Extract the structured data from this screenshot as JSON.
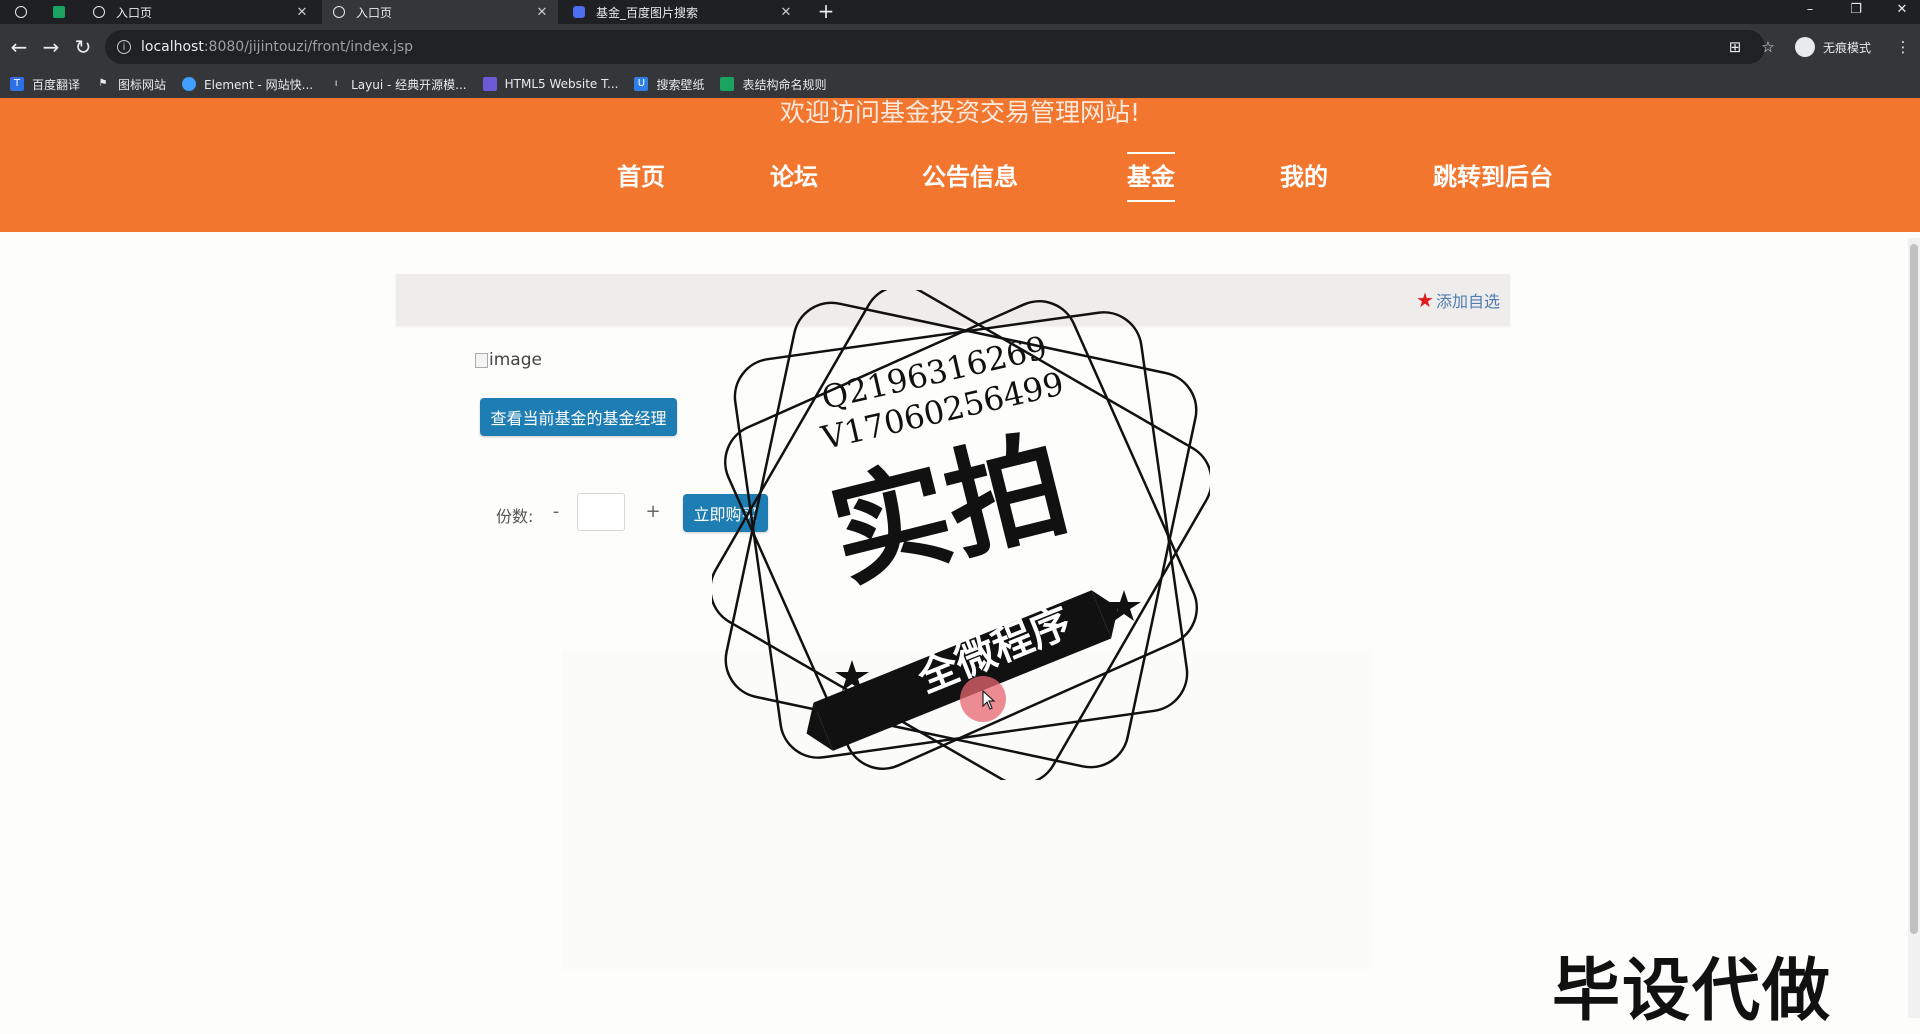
{
  "browser": {
    "tabs": [
      {
        "title": "入口页"
      },
      {
        "title": "入口页"
      },
      {
        "title": "基金_百度图片搜索"
      }
    ],
    "address": {
      "host": "localhost",
      "path": ":8080/jijintouzi/front/index.jsp"
    },
    "profile_label": "无痕模式",
    "bookmarks": [
      {
        "label": "百度翻译",
        "icon": "translate-icon",
        "color": "#2f6fe6"
      },
      {
        "label": "图标网站",
        "icon": "flag-icon",
        "color": "#35363a"
      },
      {
        "label": "Element - 网站快...",
        "icon": "element-icon",
        "color": "#409eff"
      },
      {
        "label": "Layui - 经典开源模...",
        "icon": "layui-icon",
        "color": "#35363a"
      },
      {
        "label": "HTML5 Website T...",
        "icon": "html5-icon",
        "color": "#6b5bd6"
      },
      {
        "label": "搜索壁纸",
        "icon": "wallpaper-icon",
        "color": "#2f7de6"
      },
      {
        "label": "表结构命名规则",
        "icon": "sheet-icon",
        "color": "#1aa260"
      }
    ]
  },
  "site": {
    "welcome": "欢迎访问基金投资交易管理网站!",
    "nav": [
      {
        "label": "首页"
      },
      {
        "label": "论坛"
      },
      {
        "label": "公告信息"
      },
      {
        "label": "基金",
        "active": true
      },
      {
        "label": "我的"
      },
      {
        "label": "跳转到后台"
      }
    ],
    "favorite_label": "添加自选",
    "image_alt": "image",
    "manager_button": "查看当前基金的基金经理",
    "quantity": {
      "label": "份数:",
      "minus": "-",
      "plus": "+",
      "value": ""
    },
    "buy_button": "立即购买"
  },
  "overlay": {
    "contact_line1": "Q2196316269",
    "contact_line2": "V17060256499",
    "stamp_main": "实拍",
    "stamp_ribbon": "全微程序",
    "corner": "毕设代做"
  },
  "colors": {
    "brand": "#f2762e",
    "button": "#1e7db3",
    "link": "#4f7db3",
    "star": "#e01b1b"
  }
}
